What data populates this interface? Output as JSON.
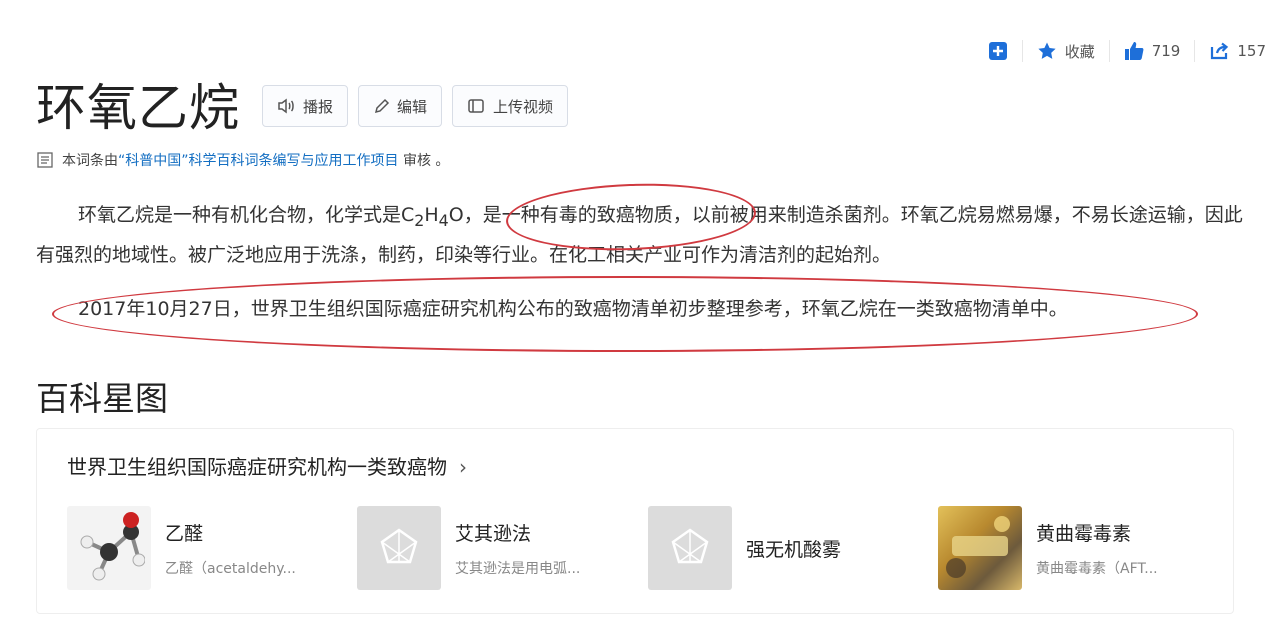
{
  "topbar": {
    "collect_label": "收藏",
    "like_count": "719",
    "share_count": "157"
  },
  "header": {
    "title": "环氧乙烷",
    "buttons": {
      "broadcast": "播报",
      "edit": "编辑",
      "upload_video": "上传视频"
    }
  },
  "review": {
    "prefix": "本词条由",
    "link": "“科普中国”科学百科词条编写与应用工作项目",
    "suffix": " 审核 。"
  },
  "content": {
    "p1_a": "环氧乙烷是一种有机化合物，化学式是C",
    "p1_sub1": "2",
    "p1_b": "H",
    "p1_sub2": "4",
    "p1_c": "O，是一种有毒的致癌物质，以前被用来制造杀菌剂。环氧乙烷易燃易爆，不易长途运输，因此有强烈的地域性。被广泛地应用于洗涤，制药，印染等行业。在化工相关产业可作为清洁剂的起始剂。",
    "p2": "2017年10月27日，世界卫生组织国际癌症研究机构公布的致癌物清单初步整理参考，环氧乙烷在一类致癌物清单中。"
  },
  "starmap": {
    "section_title": "百科星图",
    "card_title": "世界卫生组织国际癌症研究机构一类致癌物",
    "chevron": "›",
    "items": [
      {
        "name": "乙醛",
        "desc": "乙醛（acetaldehy..."
      },
      {
        "name": "艾其逊法",
        "desc": "艾其逊法是用电弧..."
      },
      {
        "name": "强无机酸雾",
        "desc": ""
      },
      {
        "name": "黄曲霉毒素",
        "desc": "黄曲霉毒素（AFT..."
      }
    ]
  },
  "colors": {
    "accent": "#1e6fd9",
    "annotation_red": "#d03a40",
    "link": "#136ec2"
  }
}
